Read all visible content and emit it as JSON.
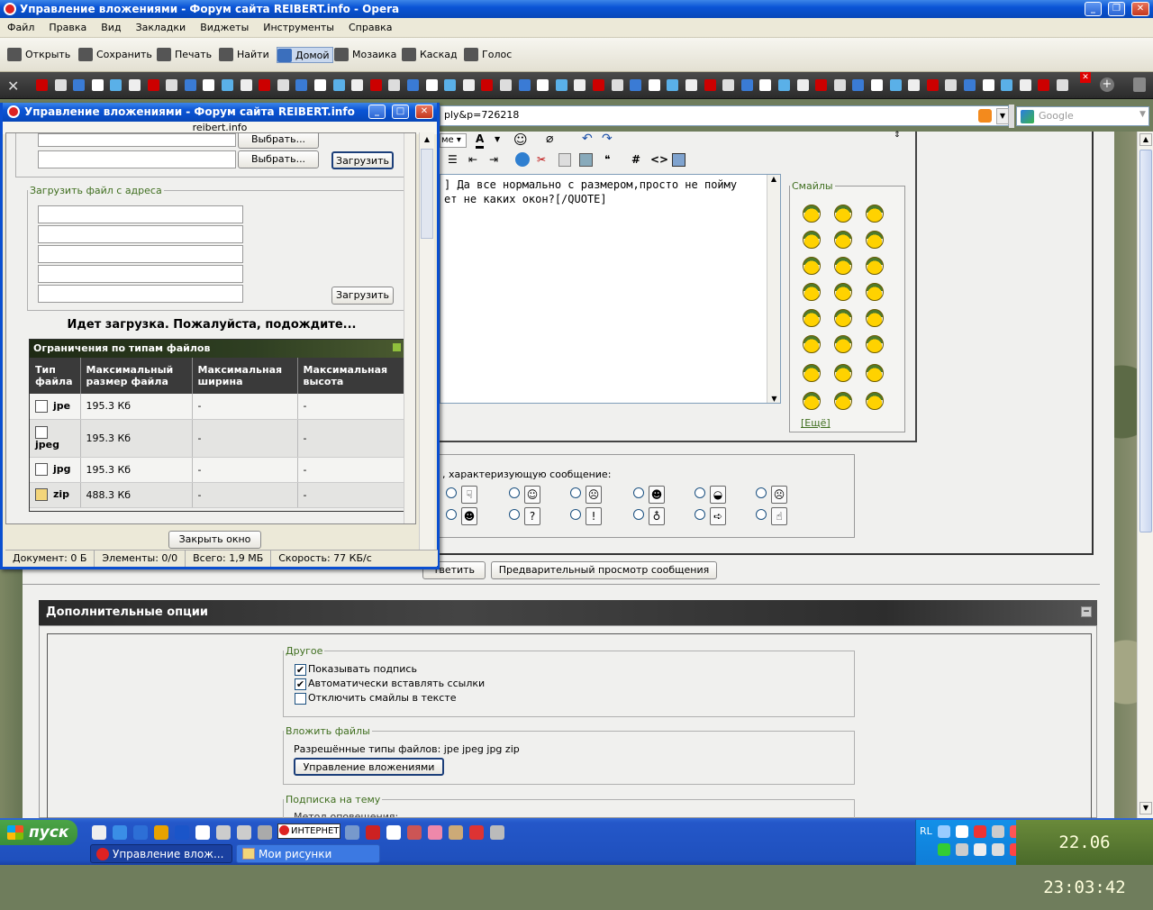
{
  "window": {
    "title": "Управление вложениями - Форум сайта REIBERT.info - Opera"
  },
  "menu": [
    "Файл",
    "Правка",
    "Вид",
    "Закладки",
    "Виджеты",
    "Инструменты",
    "Справка"
  ],
  "toolbar": {
    "open": "Открыть",
    "save": "Сохранить",
    "print": "Печать",
    "find": "Найти",
    "home": "Домой",
    "mosaic": "Мозаика",
    "cascade": "Каскад",
    "voice": "Голос"
  },
  "address": {
    "value": "ply&p=726218",
    "search_placeholder": "Google"
  },
  "editor": {
    "font_select": "ме",
    "text": "] Да все нормально с размером,просто не пойму\nет не каких окон?[/QUOTE]"
  },
  "smilies": {
    "legend": "Смайлы",
    "more": "[Ещё]"
  },
  "icons": {
    "prompt": ", характеризующую сообщение:"
  },
  "buttons": {
    "reply": "тветить",
    "preview": "Предварительный просмотр сообщения"
  },
  "extra": {
    "header": "Дополнительные опции",
    "other": {
      "legend": "Другое",
      "items": [
        {
          "label": "Показывать подпись",
          "checked": true
        },
        {
          "label": "Автоматически вставлять ссылки",
          "checked": true
        },
        {
          "label": "Отключить смайлы в тексте",
          "checked": false
        }
      ]
    },
    "attach": {
      "legend": "Вложить файлы",
      "allowed": "Разрешённые типы файлов: jpe jpeg jpg zip",
      "manage": "Управление вложениями"
    },
    "subscribe": {
      "legend": "Подписка на тему",
      "partial": "Метод оповещения:"
    }
  },
  "popup": {
    "title": "Управление вложениями - Форум сайта REIBERT.info",
    "host": "reibert.info",
    "choose": "Выбрать...",
    "upload": "Загрузить",
    "url_legend": "Загрузить файл с адреса",
    "loading": "Идет загрузка. Пожалуйста, подождите...",
    "limits_title": "Ограничения по типам файлов",
    "columns": [
      "Тип файла",
      "Максимальный размер файла",
      "Максимальная ширина",
      "Максимальная высота"
    ],
    "rows": [
      {
        "type": "jpe",
        "size": "195.3 Кб",
        "w": "-",
        "h": "-"
      },
      {
        "type": "jpeg",
        "size": "195.3 Кб",
        "w": "-",
        "h": "-"
      },
      {
        "type": "jpg",
        "size": "195.3 Кб",
        "w": "-",
        "h": "-"
      },
      {
        "type": "zip",
        "size": "488.3 Кб",
        "w": "-",
        "h": "-"
      }
    ],
    "close": "Закрыть окно",
    "status": {
      "doc": "Документ:  0 Б",
      "elements": "Элементы:  0/0",
      "total": "Всего:  1,9 МБ",
      "speed": "Скорость:  77 КБ/с"
    }
  },
  "taskbar": {
    "start": "пуск",
    "internet": "ИНТЕРНЕТ",
    "tasks": [
      "Управление влож...",
      "Мои рисунки"
    ],
    "lang": "RL",
    "clock": "22.06 23:03:42"
  }
}
